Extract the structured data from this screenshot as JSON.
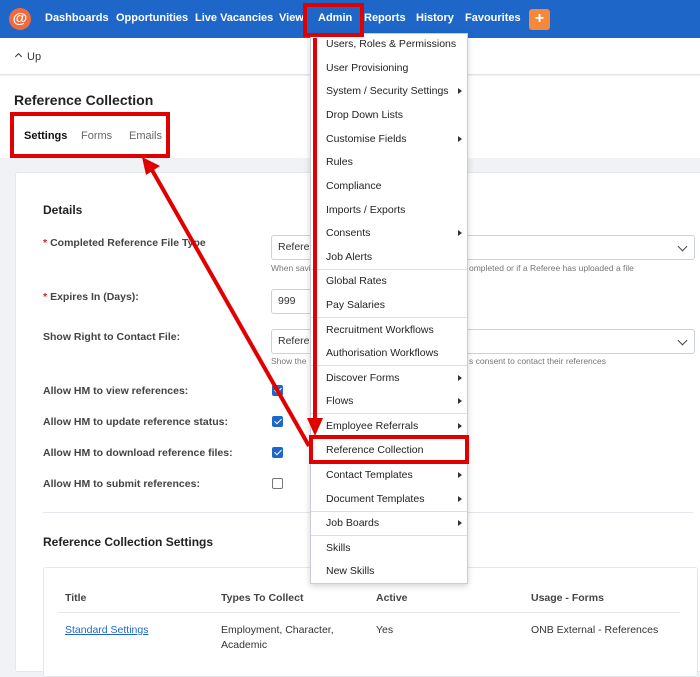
{
  "nav": {
    "logo": "@",
    "items": [
      "Dashboards",
      "Opportunities",
      "Live Vacancies",
      "View",
      "Admin",
      "Reports",
      "History",
      "Favourites"
    ],
    "plus": "+"
  },
  "up": {
    "label": "Up"
  },
  "page": {
    "title": "Reference Collection",
    "tabs": [
      "Settings",
      "Forms",
      "Emails"
    ]
  },
  "details": {
    "title": "Details",
    "completed_label": "Completed Reference File Type",
    "completed_value": "Referer",
    "completed_help_left": "When savi",
    "completed_help_right": "ompleted or if a Referee has uploaded a file",
    "expires_label": "Expires In (Days):",
    "expires_value": "999",
    "show_right_label": "Show Right to Contact File:",
    "show_right_value": "Referer",
    "show_right_help_left": "Show the",
    "show_right_help_right": "s consent to contact their references",
    "hm_view": "Allow HM to view references:",
    "hm_update": "Allow HM to update reference status:",
    "hm_download": "Allow HM to download reference files:",
    "hm_submit": "Allow HM to submit references:"
  },
  "settings_section": {
    "title": "Reference Collection Settings",
    "columns": [
      "Title",
      "Types To Collect",
      "Active",
      "Usage - Forms"
    ],
    "row": {
      "title": "Standard Settings",
      "types_line1": "Employment, Character,",
      "types_line2": "Academic",
      "active": "Yes",
      "usage": "ONB External - References"
    }
  },
  "menu": {
    "items": [
      "Users, Roles & Permissions",
      "User Provisioning",
      "System / Security Settings",
      "Drop Down Lists",
      "Customise Fields",
      "Rules",
      "Compliance",
      "Imports / Exports",
      "Consents",
      "Job Alerts",
      "Global Rates",
      "Pay Salaries",
      "Recruitment Workflows",
      "Authorisation Workflows",
      "Discover Forms",
      "Flows",
      "Employee Referrals",
      "Reference Collection",
      "Contact Templates",
      "Document Templates",
      "Job Boards",
      "Skills",
      "New Skills"
    ]
  },
  "colors": {
    "nav": "#1e67c9",
    "accent_orange": "#f5883b",
    "annotation_red": "#e10000"
  }
}
